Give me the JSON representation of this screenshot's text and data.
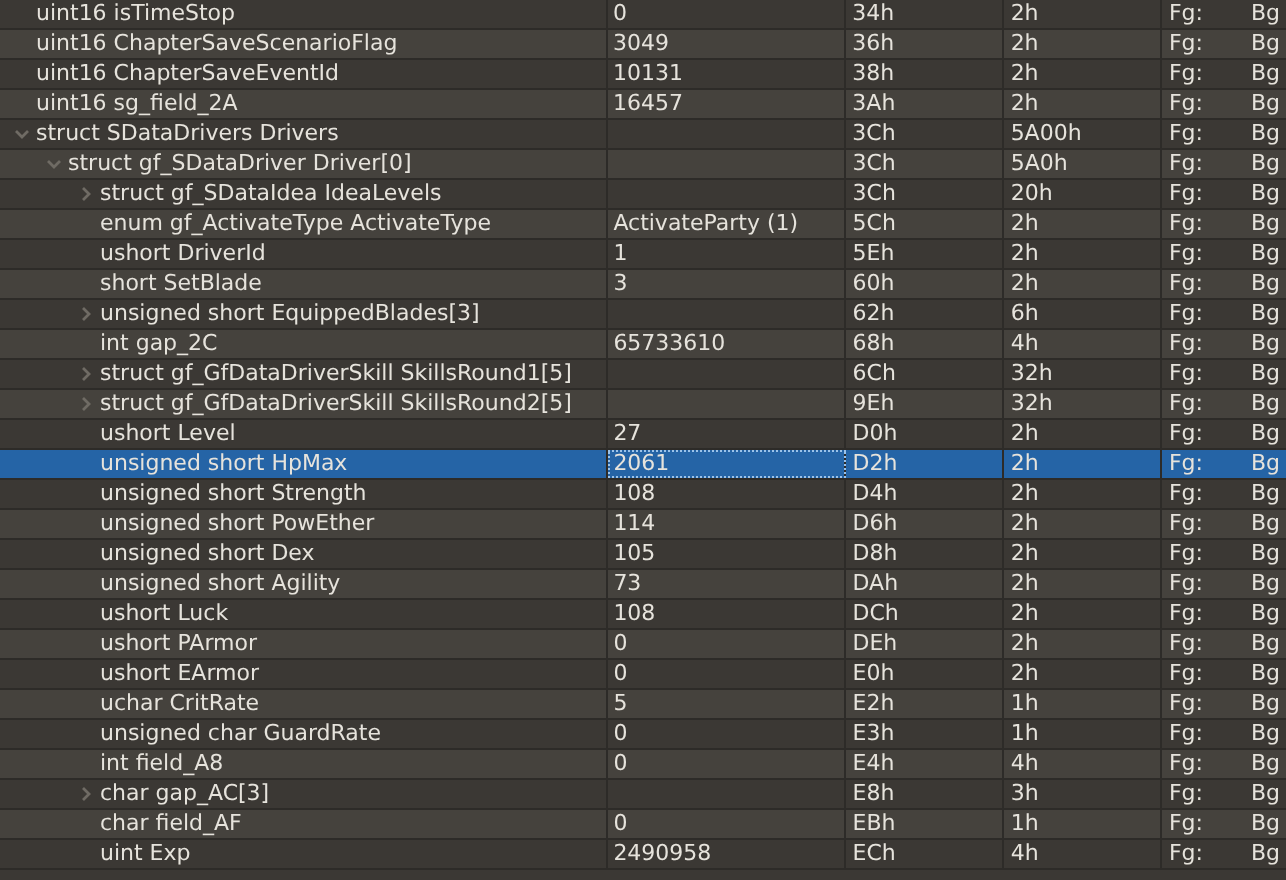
{
  "rows": [
    {
      "name": "uint16 isTimeStop",
      "value": "0",
      "start": "34h",
      "size": "2h",
      "fg": "Fg:",
      "bg": "Bg",
      "selected": false
    },
    {
      "name": "uint16 ChapterSaveScenarioFlag",
      "value": "3049",
      "start": "36h",
      "size": "2h",
      "fg": "Fg:",
      "bg": "Bg",
      "selected": false
    },
    {
      "name": "uint16 ChapterSaveEventId",
      "value": "10131",
      "start": "38h",
      "size": "2h",
      "fg": "Fg:",
      "bg": "Bg",
      "selected": false
    },
    {
      "name": "uint16 sg_field_2A",
      "value": "16457",
      "start": "3Ah",
      "size": "2h",
      "fg": "Fg:",
      "bg": "Bg",
      "selected": false
    },
    {
      "name": "struct SDataDrivers Drivers",
      "start": "3Ch",
      "size": "5A00h",
      "fg": "Fg:",
      "bg": "Bg",
      "selected": false,
      "expanded": true,
      "children": [
        {
          "name": "struct gf_SDataDriver Driver[0]",
          "start": "3Ch",
          "size": "5A0h",
          "fg": "Fg:",
          "bg": "Bg",
          "selected": false,
          "expanded": true,
          "children": [
            {
              "name": "struct gf_SDataIdea IdeaLevels",
              "start": "3Ch",
              "size": "20h",
              "fg": "Fg:",
              "bg": "Bg",
              "selected": false,
              "expanded": false
            },
            {
              "name": "enum gf_ActivateType ActivateType",
              "value": "ActivateParty (1)",
              "start": "5Ch",
              "size": "2h",
              "fg": "Fg:",
              "bg": "Bg",
              "selected": false
            },
            {
              "name": "ushort DriverId",
              "value": "1",
              "start": "5Eh",
              "size": "2h",
              "fg": "Fg:",
              "bg": "Bg",
              "selected": false
            },
            {
              "name": "short SetBlade",
              "value": "3",
              "start": "60h",
              "size": "2h",
              "fg": "Fg:",
              "bg": "Bg",
              "selected": false
            },
            {
              "name": "unsigned short EquippedBlades[3]",
              "start": "62h",
              "size": "6h",
              "fg": "Fg:",
              "bg": "Bg",
              "selected": false,
              "expanded": false
            },
            {
              "name": "int gap_2C",
              "value": "65733610",
              "start": "68h",
              "size": "4h",
              "fg": "Fg:",
              "bg": "Bg",
              "selected": false
            },
            {
              "name": "struct gf_GfDataDriverSkill SkillsRound1[5]",
              "start": "6Ch",
              "size": "32h",
              "fg": "Fg:",
              "bg": "Bg",
              "selected": false,
              "expanded": false
            },
            {
              "name": "struct gf_GfDataDriverSkill SkillsRound2[5]",
              "start": "9Eh",
              "size": "32h",
              "fg": "Fg:",
              "bg": "Bg",
              "selected": false,
              "expanded": false
            },
            {
              "name": "ushort Level",
              "value": "27",
              "start": "D0h",
              "size": "2h",
              "fg": "Fg:",
              "bg": "Bg",
              "selected": false
            },
            {
              "name": "unsigned short HpMax",
              "value": "2061",
              "start": "D2h",
              "size": "2h",
              "fg": "Fg:",
              "bg": "Bg",
              "selected": true
            },
            {
              "name": "unsigned short Strength",
              "value": "108",
              "start": "D4h",
              "size": "2h",
              "fg": "Fg:",
              "bg": "Bg",
              "selected": false
            },
            {
              "name": "unsigned short PowEther",
              "value": "114",
              "start": "D6h",
              "size": "2h",
              "fg": "Fg:",
              "bg": "Bg",
              "selected": false
            },
            {
              "name": "unsigned short Dex",
              "value": "105",
              "start": "D8h",
              "size": "2h",
              "fg": "Fg:",
              "bg": "Bg",
              "selected": false
            },
            {
              "name": "unsigned short Agility",
              "value": "73",
              "start": "DAh",
              "size": "2h",
              "fg": "Fg:",
              "bg": "Bg",
              "selected": false
            },
            {
              "name": "ushort Luck",
              "value": "108",
              "start": "DCh",
              "size": "2h",
              "fg": "Fg:",
              "bg": "Bg",
              "selected": false
            },
            {
              "name": "ushort PArmor",
              "value": "0",
              "start": "DEh",
              "size": "2h",
              "fg": "Fg:",
              "bg": "Bg",
              "selected": false
            },
            {
              "name": "ushort EArmor",
              "value": "0",
              "start": "E0h",
              "size": "2h",
              "fg": "Fg:",
              "bg": "Bg",
              "selected": false
            },
            {
              "name": "uchar CritRate",
              "value": "5",
              "start": "E2h",
              "size": "1h",
              "fg": "Fg:",
              "bg": "Bg",
              "selected": false
            },
            {
              "name": "unsigned char GuardRate",
              "value": "0",
              "start": "E3h",
              "size": "1h",
              "fg": "Fg:",
              "bg": "Bg",
              "selected": false
            },
            {
              "name": "int field_A8",
              "value": "0",
              "start": "E4h",
              "size": "4h",
              "fg": "Fg:",
              "bg": "Bg",
              "selected": false
            },
            {
              "name": "char gap_AC[3]",
              "start": "E8h",
              "size": "3h",
              "fg": "Fg:",
              "bg": "Bg",
              "selected": false,
              "expanded": false
            },
            {
              "name": "char field_AF",
              "value": "0",
              "start": "EBh",
              "size": "1h",
              "fg": "Fg:",
              "bg": "Bg",
              "selected": false
            },
            {
              "name": "uint Exp",
              "value": "2490958",
              "start": "ECh",
              "size": "4h",
              "fg": "Fg:",
              "bg": "Bg",
              "selected": false
            }
          ]
        }
      ]
    }
  ]
}
